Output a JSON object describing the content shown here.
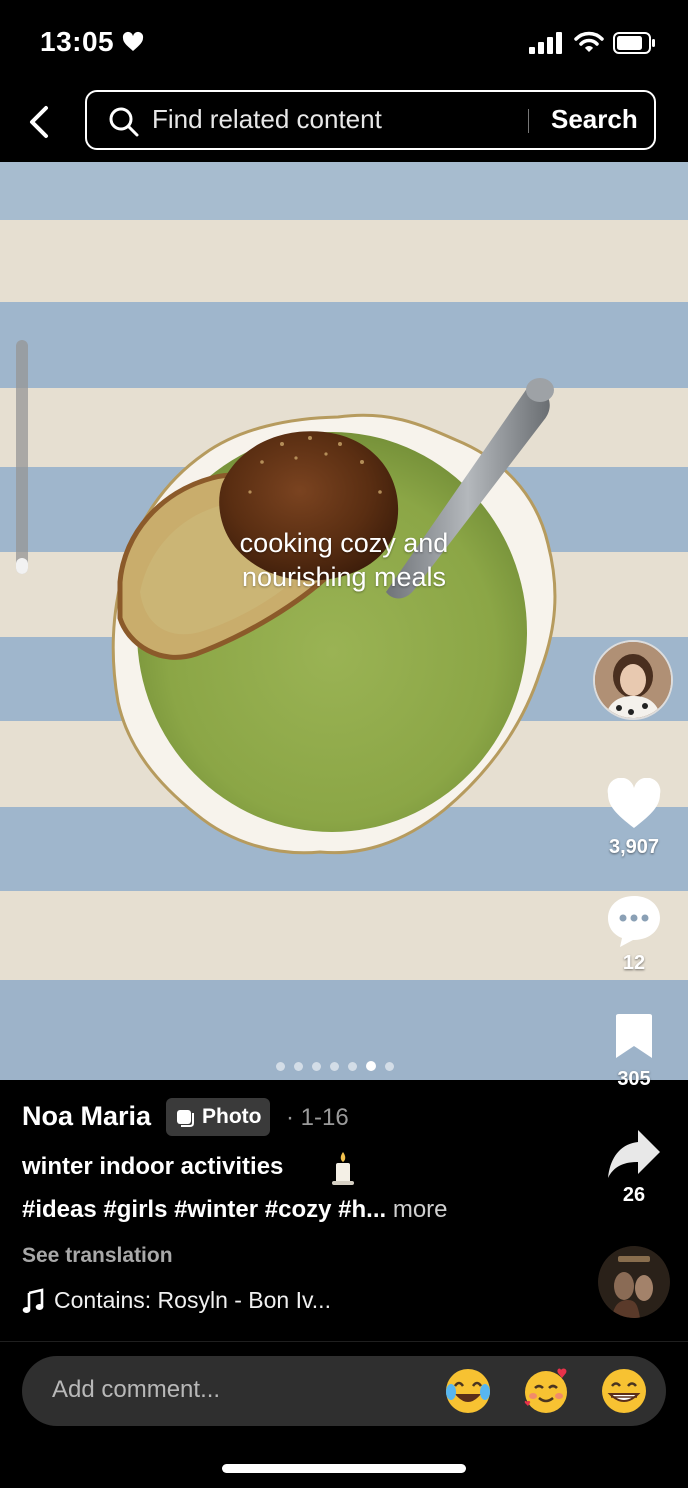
{
  "status_bar": {
    "time": "13:05"
  },
  "search": {
    "placeholder": "Find related content",
    "button_label": "Search"
  },
  "photo": {
    "caption_line1": "cooking cozy and",
    "caption_line2": "nourishing meals",
    "carousel": {
      "total": 7,
      "active_index": 5
    }
  },
  "rail": {
    "likes": "3,907",
    "comments": "12",
    "saves": "305",
    "shares": "26"
  },
  "post": {
    "username": "Noa Maria",
    "badge_label": "Photo",
    "date": "· 1-16",
    "title": "winter indoor activities",
    "hashtags": "#ideas #girls #winter #cozy #h...",
    "more_label": "more",
    "see_translation": "See translation",
    "music": "Contains: Rosyln - Bon Iv..."
  },
  "comment_bar": {
    "placeholder": "Add comment..."
  },
  "icons": {
    "back": "chevron-left-icon",
    "search": "search-icon",
    "like": "heart-icon",
    "comment": "speech-bubble-icon",
    "save": "bookmark-icon",
    "share": "share-arrow-icon",
    "music": "music-note-icon"
  },
  "colors": {
    "background": "#000000",
    "stripe_blue": "#9fb6cc",
    "stripe_cream": "#e8e1d3",
    "soup": "#8da848"
  }
}
